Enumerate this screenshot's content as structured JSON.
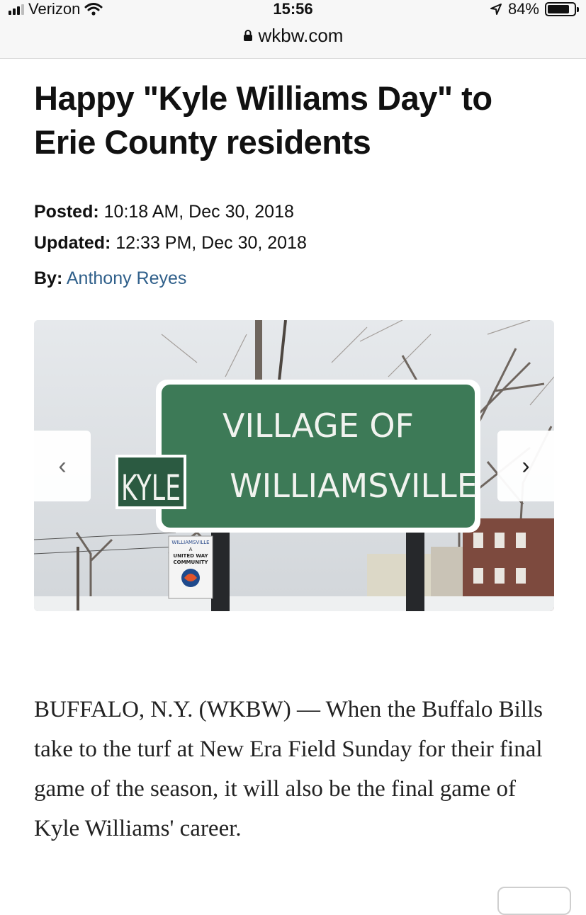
{
  "status_bar": {
    "carrier": "Verizon",
    "time": "15:56",
    "battery": "84%",
    "battery_level": 0.84,
    "icons": [
      "signal-icon",
      "wifi-icon",
      "location-icon",
      "battery-icon"
    ]
  },
  "browser": {
    "url": "wkbw.com",
    "icons": [
      "lock-icon"
    ]
  },
  "article": {
    "headline": "Happy \"Kyle Williams Day\" to Erie County residents",
    "posted_label": "Posted:",
    "posted_value": "10:18 AM, Dec 30, 2018",
    "updated_label": "Updated:",
    "updated_value": "12:33 PM, Dec 30, 2018",
    "by_label": "By:",
    "author": "Anthony Reyes",
    "body": "BUFFALO, N.Y. (WKBW) — When the Buffalo Bills take to the turf at New Era Field Sunday for their final game of the season, it will also be the final game of Kyle Williams' career."
  },
  "photo": {
    "sign_line1": "VILLAGE OF",
    "sign_line2": "WILLIAMSVILLE",
    "sticker": "KYLE",
    "small_sign_lines": [
      "WILLIAMSVILLE",
      "A",
      "UNITED WAY",
      "COMMUNITY"
    ],
    "prev_label": "‹",
    "next_label": "›"
  },
  "colors": {
    "sign_green": "#3d7a57",
    "author_link": "#2f5f8a"
  }
}
